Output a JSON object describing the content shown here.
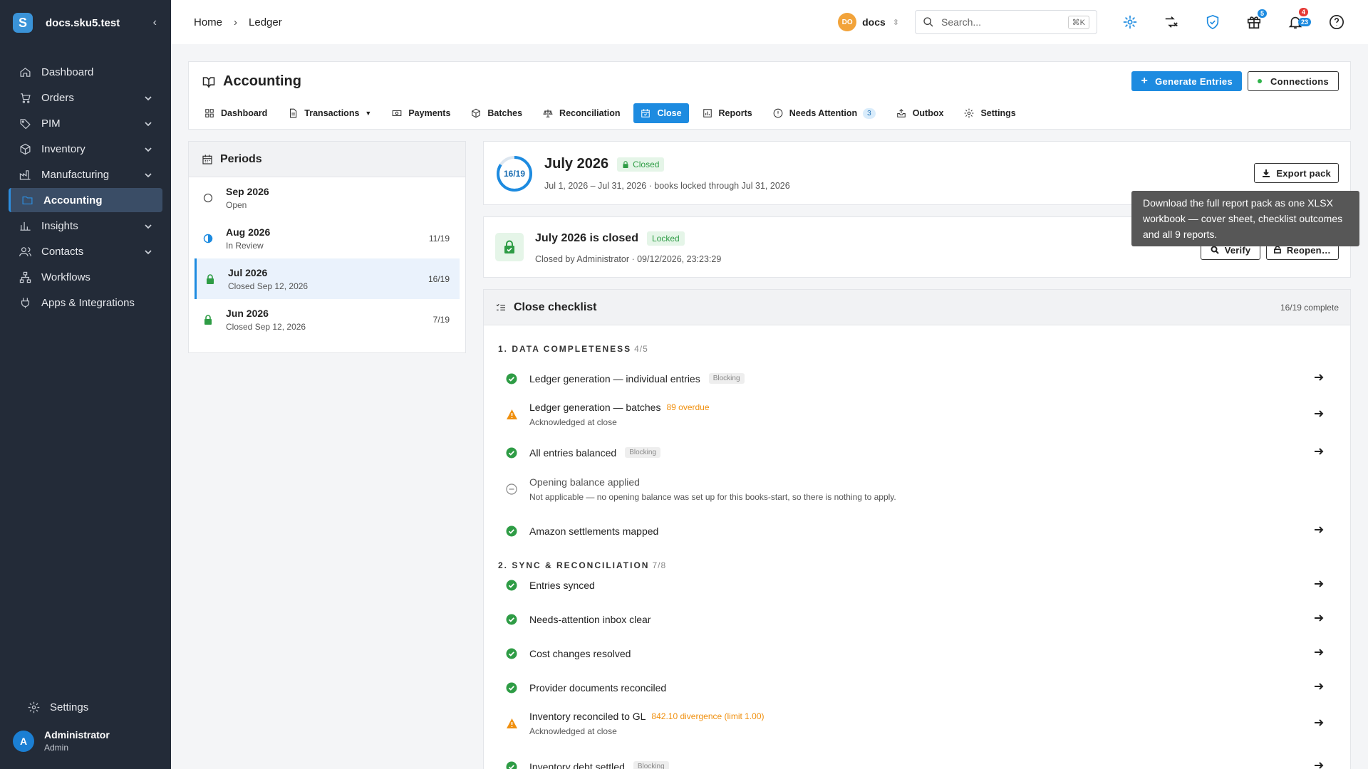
{
  "app": {
    "site": "docs.sku5.test",
    "logo_letter": "S"
  },
  "sidebar": {
    "items": [
      {
        "label": "Dashboard",
        "icon": "home-icon",
        "chevron": false
      },
      {
        "label": "Orders",
        "icon": "cart-icon",
        "chevron": true
      },
      {
        "label": "PIM",
        "icon": "tag-icon",
        "chevron": true
      },
      {
        "label": "Inventory",
        "icon": "box-icon",
        "chevron": true
      },
      {
        "label": "Manufacturing",
        "icon": "factory-icon",
        "chevron": true
      },
      {
        "label": "Accounting",
        "icon": "ledger-icon",
        "chevron": false,
        "active": true
      },
      {
        "label": "Insights",
        "icon": "chart-icon",
        "chevron": true
      },
      {
        "label": "Contacts",
        "icon": "contacts-icon",
        "chevron": true
      },
      {
        "label": "Workflows",
        "icon": "workflow-icon",
        "chevron": false
      },
      {
        "label": "Apps & Integrations",
        "icon": "plug-icon",
        "chevron": false
      }
    ],
    "settings_label": "Settings",
    "user": {
      "initial": "A",
      "name": "Administrator",
      "role": "Admin"
    }
  },
  "topbar": {
    "breadcrumb": [
      "Home",
      "Ledger"
    ],
    "workspace": {
      "initials": "DO",
      "name": "docs"
    },
    "search_placeholder": "Search...",
    "search_shortcut": "⌘K",
    "gift_badge": "5",
    "notif_badge_red": "4",
    "notif_badge_blue": "23"
  },
  "header": {
    "title": "Accounting",
    "generate_label": "Generate Entries",
    "connections_label": "Connections",
    "tabs": [
      {
        "label": "Dashboard",
        "icon": "grid-icon"
      },
      {
        "label": "Transactions",
        "icon": "document-icon",
        "caret": true
      },
      {
        "label": "Payments",
        "icon": "cash-icon"
      },
      {
        "label": "Batches",
        "icon": "cube-icon"
      },
      {
        "label": "Reconciliation",
        "icon": "scale-icon"
      },
      {
        "label": "Close",
        "icon": "calendar-check-icon",
        "active": true
      },
      {
        "label": "Reports",
        "icon": "report-icon"
      },
      {
        "label": "Needs Attention",
        "icon": "info-icon",
        "count": "3"
      },
      {
        "label": "Outbox",
        "icon": "outbox-icon"
      },
      {
        "label": "Settings",
        "icon": "gear-icon"
      }
    ]
  },
  "periods": {
    "title": "Periods",
    "items": [
      {
        "name": "Sep 2026",
        "sub": "Open",
        "count": "",
        "state": "open"
      },
      {
        "name": "Aug 2026",
        "sub": "In Review",
        "count": "11/19",
        "state": "review"
      },
      {
        "name": "Jul 2026",
        "sub": "Closed Sep 12, 2026",
        "count": "16/19",
        "state": "closed",
        "selected": true
      },
      {
        "name": "Jun 2026",
        "sub": "Closed Sep 12, 2026",
        "count": "7/19",
        "state": "closed"
      }
    ]
  },
  "summary": {
    "ring_label": "16/19",
    "progress": 0.842,
    "title": "July 2026",
    "status": "Closed",
    "subtitle": "Jul 1, 2026 – Jul 31, 2026 · books locked through Jul 31, 2026",
    "export_label": "Export pack"
  },
  "tooltip": {
    "text": "Download the full report pack as one XLSX workbook — cover sheet, checklist outcomes and all 9 reports."
  },
  "closed": {
    "title": "July 2026 is closed",
    "badge": "Locked",
    "subtitle": "Closed by Administrator · 09/12/2026, 23:23:29",
    "verify_label": "Verify",
    "reopen_label": "Reopen…"
  },
  "checklist": {
    "title": "Close checklist",
    "complete": "16/19 complete",
    "sections": [
      {
        "title": "1. DATA COMPLETENESS",
        "count": "4/5"
      },
      {
        "title": "2. SYNC & RECONCILIATION",
        "count": "7/8"
      }
    ],
    "rows": [
      {
        "status": "ok",
        "name": "Ledger generation — individual entries",
        "tag": "Blocking",
        "warn": "",
        "sub": "",
        "arrow": true
      },
      {
        "status": "warn",
        "name": "Ledger generation — batches",
        "tag": "",
        "warn": "89 overdue",
        "sub": "Acknowledged at close",
        "arrow": true
      },
      {
        "status": "ok",
        "name": "All entries balanced",
        "tag": "Blocking",
        "warn": "",
        "sub": "",
        "arrow": true
      },
      {
        "status": "na",
        "name": "Opening balance applied",
        "tag": "",
        "warn": "",
        "sub": "Not applicable — no opening balance was set up for this books-start, so there is nothing to apply.",
        "arrow": false
      },
      {
        "status": "ok",
        "name": "Amazon settlements mapped",
        "tag": "",
        "warn": "",
        "sub": "",
        "arrow": true
      },
      {
        "status": "ok",
        "name": "Entries synced",
        "tag": "",
        "warn": "",
        "sub": "",
        "arrow": true
      },
      {
        "status": "ok",
        "name": "Needs-attention inbox clear",
        "tag": "",
        "warn": "",
        "sub": "",
        "arrow": true
      },
      {
        "status": "ok",
        "name": "Cost changes resolved",
        "tag": "",
        "warn": "",
        "sub": "",
        "arrow": true
      },
      {
        "status": "ok",
        "name": "Provider documents reconciled",
        "tag": "",
        "warn": "",
        "sub": "",
        "arrow": true
      },
      {
        "status": "warn",
        "name": "Inventory reconciled to GL",
        "tag": "",
        "warn": "842.10 divergence (limit 1.00)",
        "sub": "Acknowledged at close",
        "arrow": true
      },
      {
        "status": "ok",
        "name": "Inventory debt settled",
        "tag": "Blocking",
        "warn": "",
        "sub": "",
        "arrow": true
      }
    ]
  },
  "colors": {
    "accent": "#1d8be0",
    "sidebar": "#232b38",
    "success": "#2e9c45",
    "warning": "#f0900f"
  }
}
